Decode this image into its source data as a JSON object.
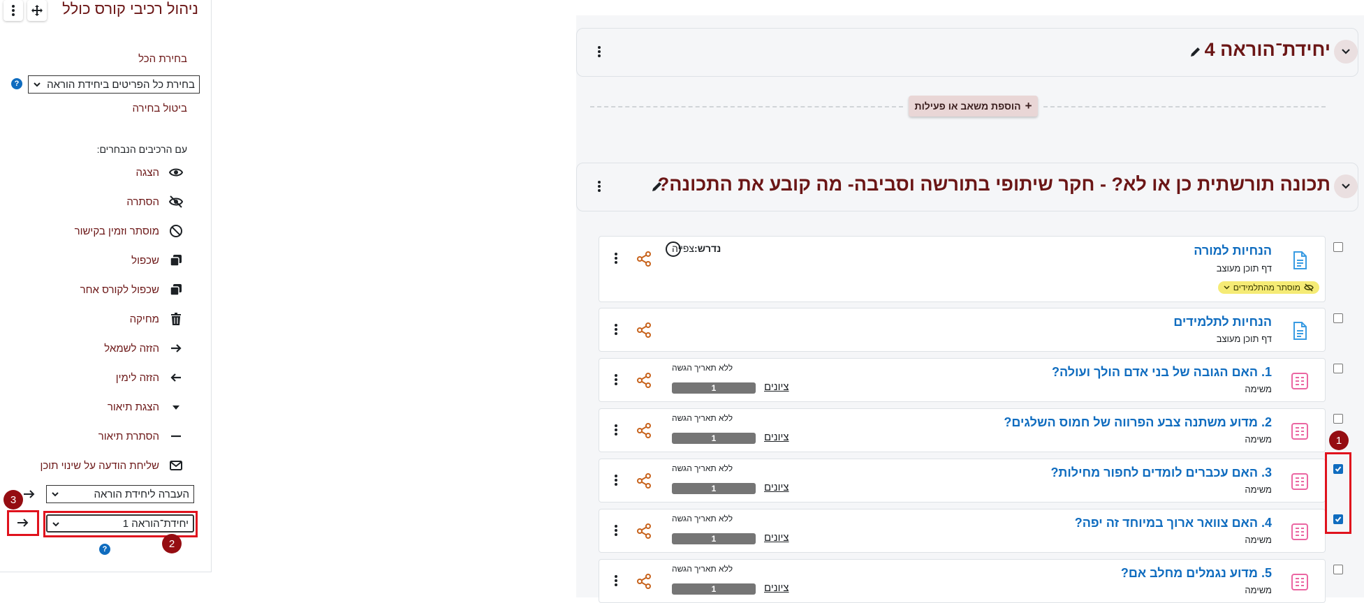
{
  "panel": {
    "title": "ניהול רכיבי קורס כולל",
    "select_all_link": "בחירת הכל",
    "select_scope_value": "בחירת כל הפריטים ביחידת הוראה",
    "cancel_selection_link": "ביטול בחירה",
    "with_selected_label": "עם הרכיבים הנבחרים:",
    "actions": [
      {
        "label": "הצגה",
        "icon": "eye-icon"
      },
      {
        "label": "הסתרה",
        "icon": "eye-slash-icon"
      },
      {
        "label": "מוסתר וזמין בקישור",
        "icon": "ban-icon"
      },
      {
        "label": "שכפול",
        "icon": "copy-icon"
      },
      {
        "label": "שכפול לקורס אחר",
        "icon": "copy-to-course-icon"
      },
      {
        "label": "מחיקה",
        "icon": "trash-icon"
      },
      {
        "label": "הזזה לשמאל",
        "icon": "arrow-right-icon"
      },
      {
        "label": "הזזה לימין",
        "icon": "arrow-left-icon"
      },
      {
        "label": "הצגת תיאור",
        "icon": "caret-down-icon"
      },
      {
        "label": "הסתרת תיאור",
        "icon": "minus-icon"
      },
      {
        "label": "שליחת הודעה על שינוי תוכן",
        "icon": "envelope-icon"
      }
    ],
    "move_to_section_placeholder": "העברה ליחידת הוראה",
    "target_section_value": "יחידת־הוראה 1",
    "help_glyph": "?",
    "annotations": [
      "1",
      "2",
      "3"
    ],
    "annotation_color": "#e0121d"
  },
  "sections": [
    {
      "title": "יחידת־הוראה 4",
      "add_button": "הוספת משאב או פעילות",
      "add_glyph": "+"
    },
    {
      "title": "תכונה תורשתית כן או לא? - חקר שיתופי בתורשה וסביבה- מה קובע את התכונה?"
    }
  ],
  "activities": [
    {
      "name": "הנחיות למורה",
      "type": "דף תוכן מעוצב",
      "icon": "page-icon",
      "checked": false,
      "hidden_badge": "מוסתר מהתלמידים",
      "completion_label": "נדרש:",
      "completion_value": "צפייה"
    },
    {
      "name": "הנחיות לתלמידים",
      "type": "דף תוכן מעוצב",
      "icon": "page-icon",
      "checked": false
    },
    {
      "name": "1. האם הגובה של בני אדם הולך ועולה?",
      "type": "משימה",
      "icon": "assignment-icon",
      "checked": false,
      "due": "ללא תאריך הגשה",
      "grades_link": "ציונים",
      "grade_count": "1"
    },
    {
      "name": "2. מדוע משתנה צבע הפרווה של חמוס השלגים?",
      "type": "משימה",
      "icon": "assignment-icon",
      "checked": false,
      "due": "ללא תאריך הגשה",
      "grades_link": "ציונים",
      "grade_count": "1"
    },
    {
      "name": "3. האם עכברים לומדים לחפור מחילות?",
      "type": "משימה",
      "icon": "assignment-icon",
      "checked": true,
      "due": "ללא תאריך הגשה",
      "grades_link": "ציונים",
      "grade_count": "1"
    },
    {
      "name": "4. האם צוואר ארוך במיוחד זה יפה?",
      "type": "משימה",
      "icon": "assignment-icon",
      "checked": true,
      "due": "ללא תאריך הגשה",
      "grades_link": "ציונים",
      "grade_count": "1"
    },
    {
      "name": "5. מדוע נגמלים מחלב אם?",
      "type": "משימה",
      "icon": "assignment-icon",
      "checked": false,
      "due": "ללא תאריך הגשה",
      "grades_link": "ציונים",
      "grade_count": "1"
    }
  ],
  "colors": {
    "brand": "#6b1616",
    "link": "#0f6cbf",
    "page_icon": "#399be2",
    "assignment_icon": "#eb66a2",
    "share": "#c8631c"
  }
}
